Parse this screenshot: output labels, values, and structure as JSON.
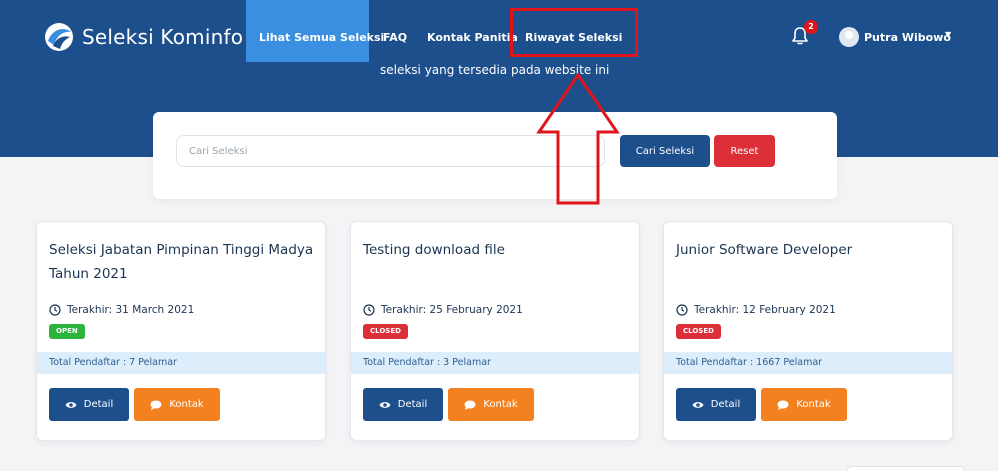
{
  "brand": {
    "name": "Seleksi Kominfo"
  },
  "nav": {
    "items": [
      {
        "label": "Lihat Semua Seleksi",
        "active": true
      },
      {
        "label": "FAQ"
      },
      {
        "label": "Kontak Panitia"
      },
      {
        "label": "Riwayat Seleksi",
        "highlighted": true
      }
    ]
  },
  "notifications": {
    "count": "2",
    "icon": "bell-icon"
  },
  "user": {
    "name": "Putra Wibowo"
  },
  "hero": {
    "subtitle": "seleksi yang tersedia pada website ini"
  },
  "search": {
    "placeholder": "Cari Seleksi",
    "value": "",
    "search_label": "Cari Seleksi",
    "reset_label": "Reset"
  },
  "cards": [
    {
      "title": "Seleksi Jabatan Pimpinan Tinggi Madya Tahun 2021",
      "deadline": "Terakhir: 31 March 2021",
      "status": "OPEN",
      "registrants": "Total Pendaftar : 7 Pelamar",
      "detail_label": "Detail",
      "contact_label": "Kontak"
    },
    {
      "title": "Testing download file",
      "deadline": "Terakhir: 25 February 2021",
      "status": "CLOSED",
      "registrants": "Total Pendaftar : 3 Pelamar",
      "detail_label": "Detail",
      "contact_label": "Kontak"
    },
    {
      "title": "Junior Software Developer",
      "deadline": "Terakhir: 12 February 2021",
      "status": "CLOSED",
      "registrants": "Total Pendaftar : 1667 Pelamar",
      "detail_label": "Detail",
      "contact_label": "Kontak"
    }
  ],
  "colors": {
    "hero_blue": "#1c4f8c",
    "nav_active": "#3a8fe0",
    "annotation_red": "#e0141b",
    "reset_red": "#dc2f37",
    "open_green": "#2ab43c",
    "contact_orange": "#f48120",
    "strip_blue": "#dceefb"
  }
}
